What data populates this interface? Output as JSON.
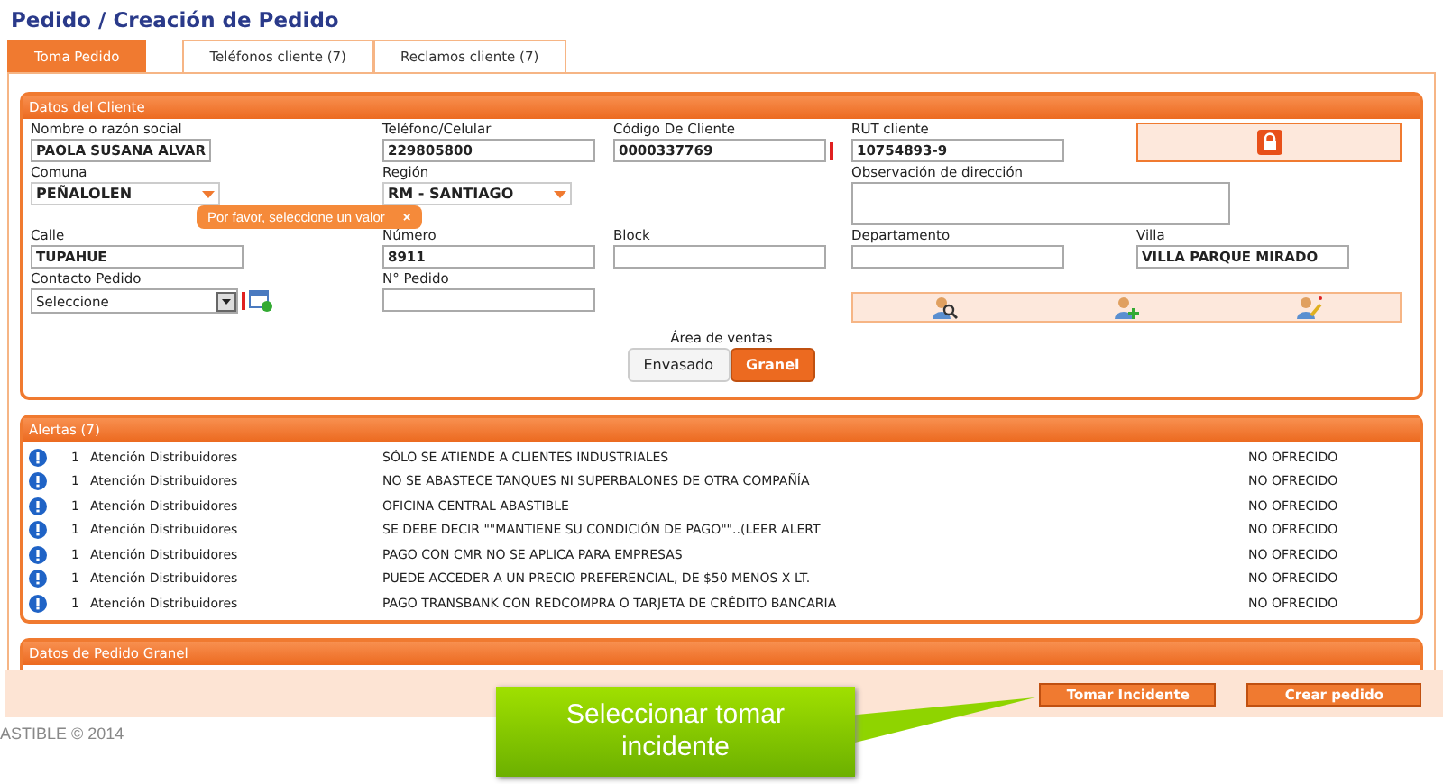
{
  "title": "Pedido / Creación de Pedido",
  "tabs": [
    {
      "label": "Toma Pedido",
      "selected": true
    },
    {
      "label": "Teléfonos cliente (7)",
      "selected": false
    },
    {
      "label": "Reclamos cliente (7)",
      "selected": false
    }
  ],
  "client": {
    "title": "Datos del Cliente",
    "rows": [
      [
        {
          "kind": "text",
          "label": "Nombre o razón social",
          "value": "PAOLA SUSANA ALVAR",
          "required": false
        },
        {
          "kind": "text",
          "label": "Teléfono/Celular",
          "value": "229805800",
          "required": false
        },
        {
          "kind": "text",
          "label": "Código De Cliente",
          "value": "0000337769",
          "required": true
        },
        {
          "kind": "text",
          "label": "RUT cliente",
          "value": "10754893-9",
          "required": false
        },
        {
          "kind": "lock"
        }
      ],
      [
        {
          "kind": "combo",
          "label": "Comuna",
          "value": "PEÑALOLEN",
          "required": false
        },
        {
          "kind": "combo",
          "label": "Región",
          "value": "RM - SANTIAGO",
          "required": false
        },
        "",
        {
          "kind": "textarea",
          "label": "Observación de dirección",
          "required": false
        }
      ],
      [
        {
          "kind": "text",
          "label": "Calle",
          "value": "TUPAHUE",
          "required": false
        },
        {
          "kind": "text",
          "label": "Número",
          "value": "8911",
          "required": false
        },
        {
          "kind": "text",
          "label": "Block",
          "required": false
        },
        {
          "kind": "text",
          "label": "Departamento",
          "required": false
        },
        {
          "kind": "text",
          "label": "Villa",
          "value": "VILLA PARQUE MIRADO",
          "required": false
        }
      ],
      [
        {
          "kind": "select",
          "label": "Contacto Pedido",
          "value": "Seleccione",
          "required": true
        },
        {
          "kind": "text",
          "label": "N° Pedido",
          "required": false
        },
        "",
        {
          "kind": "icons"
        }
      ]
    ],
    "tooltip": "Por favor, seleccione un valor",
    "tooltip_close": "×",
    "area_label": "Área de ventas",
    "area_options": [
      {
        "label": "Envasado",
        "selected": false
      },
      {
        "label": "Granel",
        "selected": true
      }
    ]
  },
  "alerts": {
    "title": "Alertas (7)",
    "rows": [
      {
        "count": "1",
        "source": "Atención Distribuidores",
        "message": "SÓLO SE ATIENDE A CLIENTES INDUSTRIALES",
        "status": "NO OFRECIDO"
      },
      {
        "count": "1",
        "source": "Atención Distribuidores",
        "message": "NO SE ABASTECE TANQUES NI SUPERBALONES DE OTRA COMPAÑÍA",
        "status": "NO OFRECIDO"
      },
      {
        "count": "1",
        "source": "Atención Distribuidores",
        "message": "OFICINA CENTRAL ABASTIBLE",
        "status": "NO OFRECIDO"
      },
      {
        "count": "1",
        "source": "Atención Distribuidores",
        "message": "SE DEBE DECIR \"\"MANTIENE SU CONDICIÓN DE PAGO\"\"..(LEER ALERT",
        "status": "NO OFRECIDO"
      },
      {
        "count": "1",
        "source": "Atención Distribuidores",
        "message": "PAGO CON CMR NO SE APLICA PARA EMPRESAS",
        "status": "NO OFRECIDO"
      },
      {
        "count": "1",
        "source": "Atención Distribuidores",
        "message": "PUEDE ACCEDER A UN PRECIO PREFERENCIAL, DE $50 MENOS X LT.",
        "status": "NO OFRECIDO"
      },
      {
        "count": "1",
        "source": "Atención Distribuidores",
        "message": "PAGO TRANSBANK CON REDCOMPRA O TARJETA DE CRÉDITO BANCARIA",
        "status": "NO OFRECIDO"
      }
    ]
  },
  "granel": {
    "title": "Datos de Pedido Granel"
  },
  "actions": [
    "Tomar Incidente",
    "Crear pedido"
  ],
  "footer": "ASTIBLE © 2014",
  "callout": "Seleccionar tomar incidente"
}
